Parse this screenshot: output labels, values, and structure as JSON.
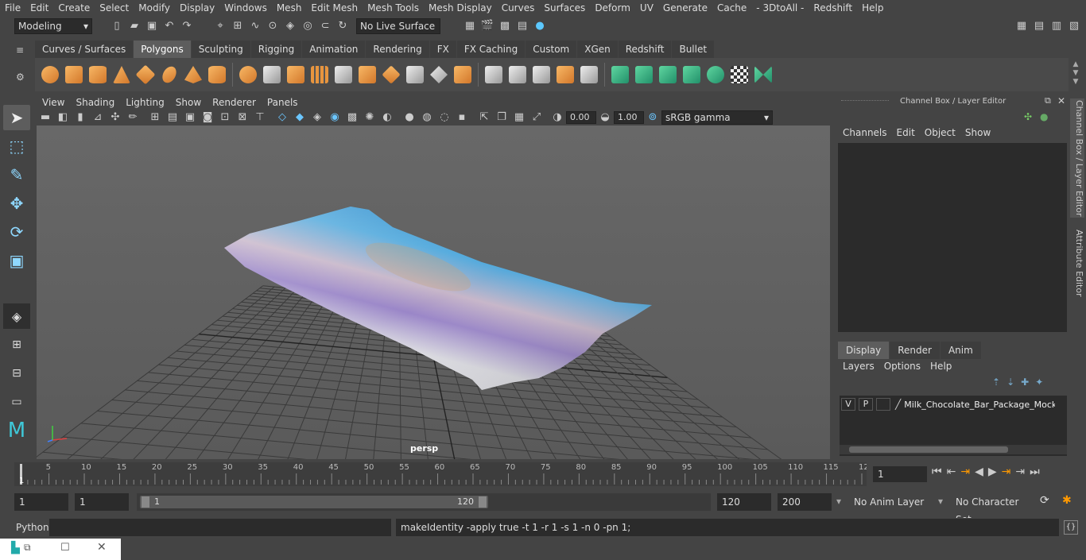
{
  "menus": [
    "File",
    "Edit",
    "Create",
    "Select",
    "Modify",
    "Display",
    "Windows",
    "Mesh",
    "Edit Mesh",
    "Mesh Tools",
    "Mesh Display",
    "Curves",
    "Surfaces",
    "Deform",
    "UV",
    "Generate",
    "Cache",
    "- 3DtoAll -",
    "Redshift",
    "Help"
  ],
  "status": {
    "mode": "Modeling",
    "live_surface": "No Live Surface"
  },
  "shelf_tabs": [
    "Curves / Surfaces",
    "Polygons",
    "Sculpting",
    "Rigging",
    "Animation",
    "Rendering",
    "FX",
    "FX Caching",
    "Custom",
    "XGen",
    "Redshift",
    "Bullet"
  ],
  "shelf_active": "Polygons",
  "viewport": {
    "menus": [
      "View",
      "Shading",
      "Lighting",
      "Show",
      "Renderer",
      "Panels"
    ],
    "exposure": "0.00",
    "gamma": "1.00",
    "color_space": "sRGB gamma",
    "camera": "persp"
  },
  "channel_box": {
    "title": "Channel Box / Layer Editor",
    "menus": [
      "Channels",
      "Edit",
      "Object",
      "Show"
    ],
    "layer_tabs": [
      "Display",
      "Render",
      "Anim"
    ],
    "layer_menus": [
      "Layers",
      "Options",
      "Help"
    ],
    "layer": {
      "v": "V",
      "p": "P",
      "name": "Milk_Chocolate_Bar_Package_Mockup"
    }
  },
  "side_tabs": [
    "Channel Box / Layer Editor",
    "Attribute Editor"
  ],
  "timeline": {
    "ticks": [
      "5",
      "10",
      "15",
      "20",
      "25",
      "30",
      "35",
      "40",
      "45",
      "50",
      "55",
      "60",
      "65",
      "70",
      "75",
      "80",
      "85",
      "90",
      "95",
      "100",
      "105",
      "110",
      "115",
      "12"
    ],
    "start_label": "1",
    "current_frame": "1"
  },
  "range": {
    "start": "1",
    "playback_start": "1",
    "slider_start": "1",
    "slider_end": "120",
    "playback_end": "120",
    "end": "200",
    "anim_layer": "No Anim Layer",
    "character_set": "No Character Set"
  },
  "cmd": {
    "lang": "Python",
    "result": "makeIdentity -apply true -t 1 -r 1 -s 1 -n 0 -pn 1;"
  }
}
